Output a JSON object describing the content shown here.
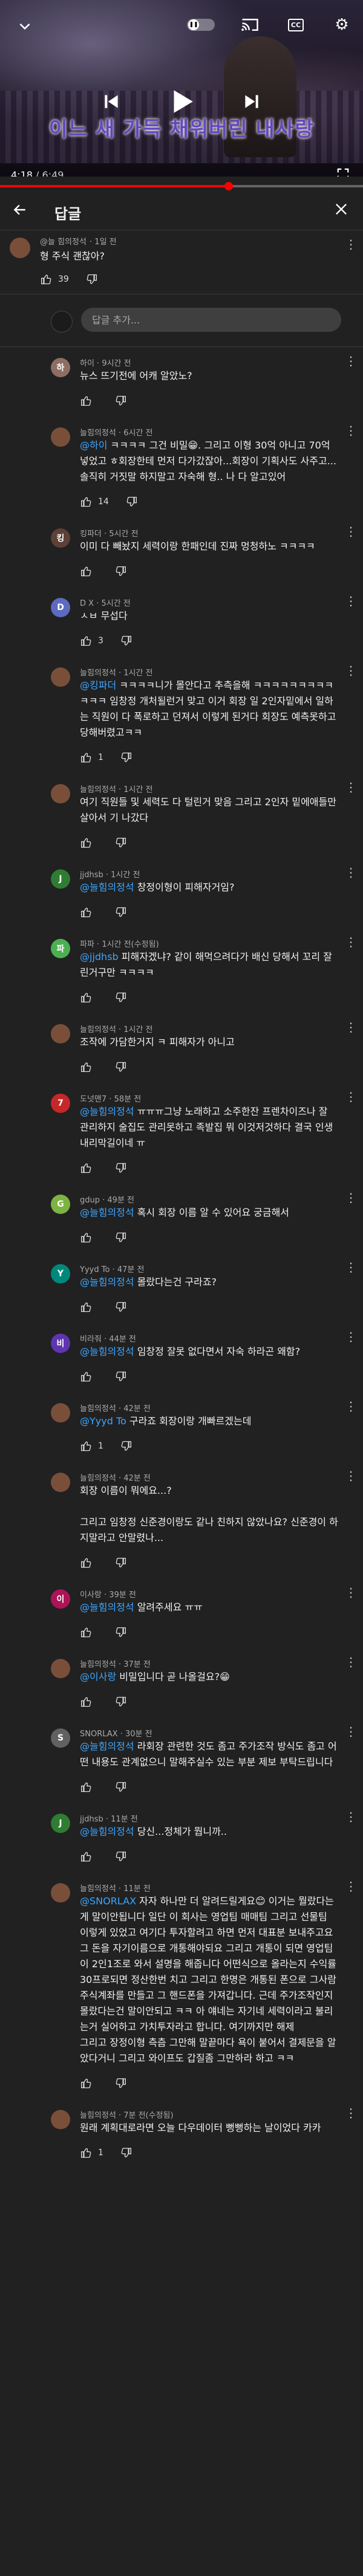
{
  "player": {
    "subtitle": "이느 새 가득 채워버린 내사랑",
    "current_time": "4:18",
    "duration": "6:49",
    "progress": 0.63,
    "autoplay_on": true
  },
  "panel": {
    "title": "답글",
    "reply_placeholder": "답글 추가..."
  },
  "parent_comment": {
    "author": "@늘 힘의정석",
    "time": "1일 전",
    "text": "형 주식 괜찮아?",
    "likes": "39",
    "avatar_color": "#7a4f3a"
  },
  "replies": [
    {
      "author": "하이",
      "time": "9시간 전",
      "text": "뉴스 뜨기전에 어캐 알았노?",
      "mention": "",
      "likes": "",
      "avatar_color": "#8d6e63",
      "avatar_letter": "하"
    },
    {
      "author": "늘힘의정석",
      "time": "6시간 전",
      "mention": "@하이",
      "text": " ㅋㅋㅋㅋ 그건 비밀😁. 그리고 이형 30억 아니고 70억 넣었고 ㅎ회장한테 먼저 다가갔잖아...회장이 기획사도 사주고... 솔직히 거짓말 하지말고 자숙해 형.. 나 다 알고있어",
      "likes": "14",
      "avatar_color": "#7a4f3a",
      "avatar_letter": ""
    },
    {
      "author": "킹파더",
      "time": "5시간 전",
      "mention": "",
      "text": "이미 다 빼놨지 세력이랑 한패인데 진짜 멍청하노 ㅋㅋㅋㅋ",
      "likes": "",
      "avatar_color": "#5d4037",
      "avatar_letter": "킹"
    },
    {
      "author": "D X",
      "time": "5시간 전",
      "mention": "",
      "text": "ㅅㅂ 무섭다",
      "likes": "3",
      "avatar_color": "#5c6bc0",
      "avatar_letter": "D"
    },
    {
      "author": "늘힘의정석",
      "time": "1시간 전",
      "mention": "@킹파더",
      "text": " ㅋㅋㅋㅋ니가 몰안다고 추측을해 ㅋㅋㅋㅋㅋㅋㅋㅋㅋㅋㅋㅋ 임창정 개처될런거 맞고 이거 회장 일 2인자밑에서 일하는 직원이 다 폭로하고 던져서 이렇게 된거다 회장도 예측못하고 당해버렸고ㅋㅋ",
      "likes": "1",
      "avatar_color": "#7a4f3a",
      "avatar_letter": ""
    },
    {
      "author": "늘힘의정석",
      "time": "1시간 전",
      "mention": "",
      "text": "여기 직원들 및 세력도 다 털린거 맞음 그리고 2인자 밑에애들만 살아서 기 나갔다",
      "likes": "",
      "avatar_color": "#7a4f3a",
      "avatar_letter": ""
    },
    {
      "author": "jjdhsb",
      "time": "1시간 전",
      "mention": "@늘힘의정석",
      "text": " 창정이형이 피해자거임?",
      "likes": "",
      "avatar_color": "#2e7d32",
      "avatar_letter": "J"
    },
    {
      "author": "파파",
      "time": "1시간 전(수정됨)",
      "mention": "@jjdhsb",
      "text": " 피해자겠냐? 같이 해먹으려다가 배신 당해서 꼬리 잘린거구만 ㅋㅋㅋㅋ",
      "likes": "",
      "avatar_color": "#4caf50",
      "avatar_letter": "파"
    },
    {
      "author": "늘힘의정석",
      "time": "1시간 전",
      "mention": "",
      "text": "조작에 가담한거지 ㅋ 피해자가 아니고",
      "likes": "",
      "avatar_color": "#7a4f3a",
      "avatar_letter": ""
    },
    {
      "author": "도넛맨7",
      "time": "58분 전",
      "mention": "@늘힘의정석",
      "text": " ㅠㅠㅠ그냥 노래하고 소주한잔 프렌차이즈나 잘 관리하지 술집도 관리못하고 족발집 뭐 이것저것하다 결국 인생 내리막길이네 ㅠ",
      "likes": "",
      "avatar_color": "#c62828",
      "avatar_letter": "7"
    },
    {
      "author": "gdup",
      "time": "49분 전",
      "mention": "@늘힘의정석",
      "text": " 혹시 회장 이름 알 수 있어요 궁금해서",
      "likes": "",
      "avatar_color": "#7cb342",
      "avatar_letter": "G"
    },
    {
      "author": "Yyyd To",
      "time": "47분 전",
      "mention": "@늘힘의정석",
      "text": " 몰랐다는건 구라죠?",
      "likes": "",
      "avatar_color": "#00897b",
      "avatar_letter": "Y"
    },
    {
      "author": "비라줘",
      "time": "44분 전",
      "mention": "@늘힘의정석",
      "text": " 임창정 잘못 없다면서 자숙 하라곤 왜함?",
      "likes": "",
      "avatar_color": "#5e35b1",
      "avatar_letter": "비"
    },
    {
      "author": "늘힘의정석",
      "time": "42분 전",
      "mention": "@Yyyd To",
      "text": " 구라죠 회장이랑 개빠르겠는데",
      "likes": "1",
      "avatar_color": "#7a4f3a",
      "avatar_letter": ""
    },
    {
      "author": "늘힘의정석",
      "time": "42분 전",
      "mention": "",
      "text": "회장 이름이 뭐에요...?\n\n그리고 임창정 신준경이랑도 같나 친하지 않았나요? 신준경이 하지말라고 안말렸나...",
      "likes": "",
      "avatar_color": "#7a4f3a",
      "avatar_letter": ""
    },
    {
      "author": "이사랑",
      "time": "39분 전",
      "mention": "@늘힘의정석",
      "text": " 알려주세요 ㅠㅠ",
      "likes": "",
      "avatar_color": "#ad1457",
      "avatar_letter": "이"
    },
    {
      "author": "늘힘의정석",
      "time": "37분 전",
      "mention": "@이사랑",
      "text": " 비밀입니다 곧 나올걸요?😁",
      "likes": "",
      "avatar_color": "#7a4f3a",
      "avatar_letter": ""
    },
    {
      "author": "SNORLAX",
      "time": "30분 전",
      "mention": "@늘힘의정석",
      "text": " 라회장 관련한 것도 좀고 주가조작 방식도 좀고 어떤 내용도 관계없으니 말해주실수 있는 부분 제보 부탁드립니다",
      "likes": "",
      "avatar_color": "#616161",
      "avatar_letter": "S"
    },
    {
      "author": "jjdhsb",
      "time": "11분 전",
      "mention": "@늘힘의정석",
      "text": " 당신...정체가 뭡니까..",
      "likes": "",
      "avatar_color": "#2e7d32",
      "avatar_letter": "J"
    },
    {
      "author": "늘힘의정석",
      "time": "11분 전",
      "mention": "@SNORLAX",
      "text": " 자자 하나만 더 알려드릴게요😊 이거는 뭘랐다는게 말이안됩니다 일단 이 회사는 영업팀 매매팀 그리고 선물팀 이렇게 있었고 여기다 투자할려고 하면 먼저 대표분 보내주고요 그 돈을 자기이름으로 개통해야되요 그리고 개통이 되면 영업팀이 2인1조로 와서 설명을 해줍니다 어떤식으로 올라는지 수익률 30프로되면 정산한번 치고 그리고 한명은 개통된 폰으로 그사람 주식계좌를 만들고 그 핸드폰을 가져갑니다. 근데 주가조작인지 몰랐다는건 말이안되고 ㅋㅋ 아 얘네는 자기네 세력이라고 불리는거 실어하고 가치투자라고 합니다. 여기까지만 해제\n그리고 장정이형 측츰 그만해 말끝마다 욕이 붙어서 결제문을 알았다거니 그리고 와이프도 갑질좀 그만하라 하고 ㅋㅋ",
      "likes": "",
      "avatar_color": "#7a4f3a",
      "avatar_letter": ""
    },
    {
      "author": "늘힘의정석",
      "time": "7분 전(수정됨)",
      "mention": "",
      "text": "원래 계획대로라면 오늘 다우데이터 뻥뻥하는 날이었다 카카",
      "likes": "1",
      "avatar_color": "#7a4f3a",
      "avatar_letter": ""
    }
  ]
}
